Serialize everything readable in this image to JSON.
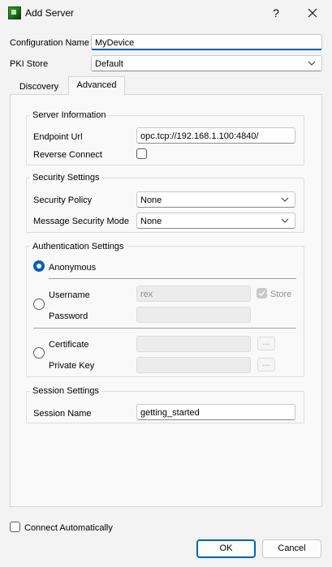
{
  "window": {
    "title": "Add Server",
    "help_glyph": "?",
    "close_glyph": "✕"
  },
  "top": {
    "config_name_label": "Configuration Name",
    "config_name_value": "MyDevice",
    "pki_store_label": "PKI Store",
    "pki_store_value": "Default"
  },
  "tabs": [
    {
      "label": "Discovery",
      "active": false
    },
    {
      "label": "Advanced",
      "active": true
    }
  ],
  "server_info": {
    "title": "Server Information",
    "endpoint_label": "Endpoint Url",
    "endpoint_value": "opc.tcp://192.168.1.100:4840/",
    "reverse_label": "Reverse Connect",
    "reverse_checked": false
  },
  "security": {
    "title": "Security Settings",
    "policy_label": "Security Policy",
    "policy_value": "None",
    "mode_label": "Message Security Mode",
    "mode_value": "None"
  },
  "auth": {
    "title": "Authentication Settings",
    "anonymous_label": "Anonymous",
    "username_label": "Username",
    "username_value": "rex",
    "store_label": "Store",
    "password_label": "Password",
    "certificate_label": "Certificate",
    "private_key_label": "Private Key",
    "browse_label": "...",
    "selected": "anonymous"
  },
  "session": {
    "title": "Session Settings",
    "name_label": "Session Name",
    "name_value": "getting_started"
  },
  "footer": {
    "connect_auto_label": "Connect Automatically",
    "ok_label": "OK",
    "cancel_label": "Cancel"
  }
}
